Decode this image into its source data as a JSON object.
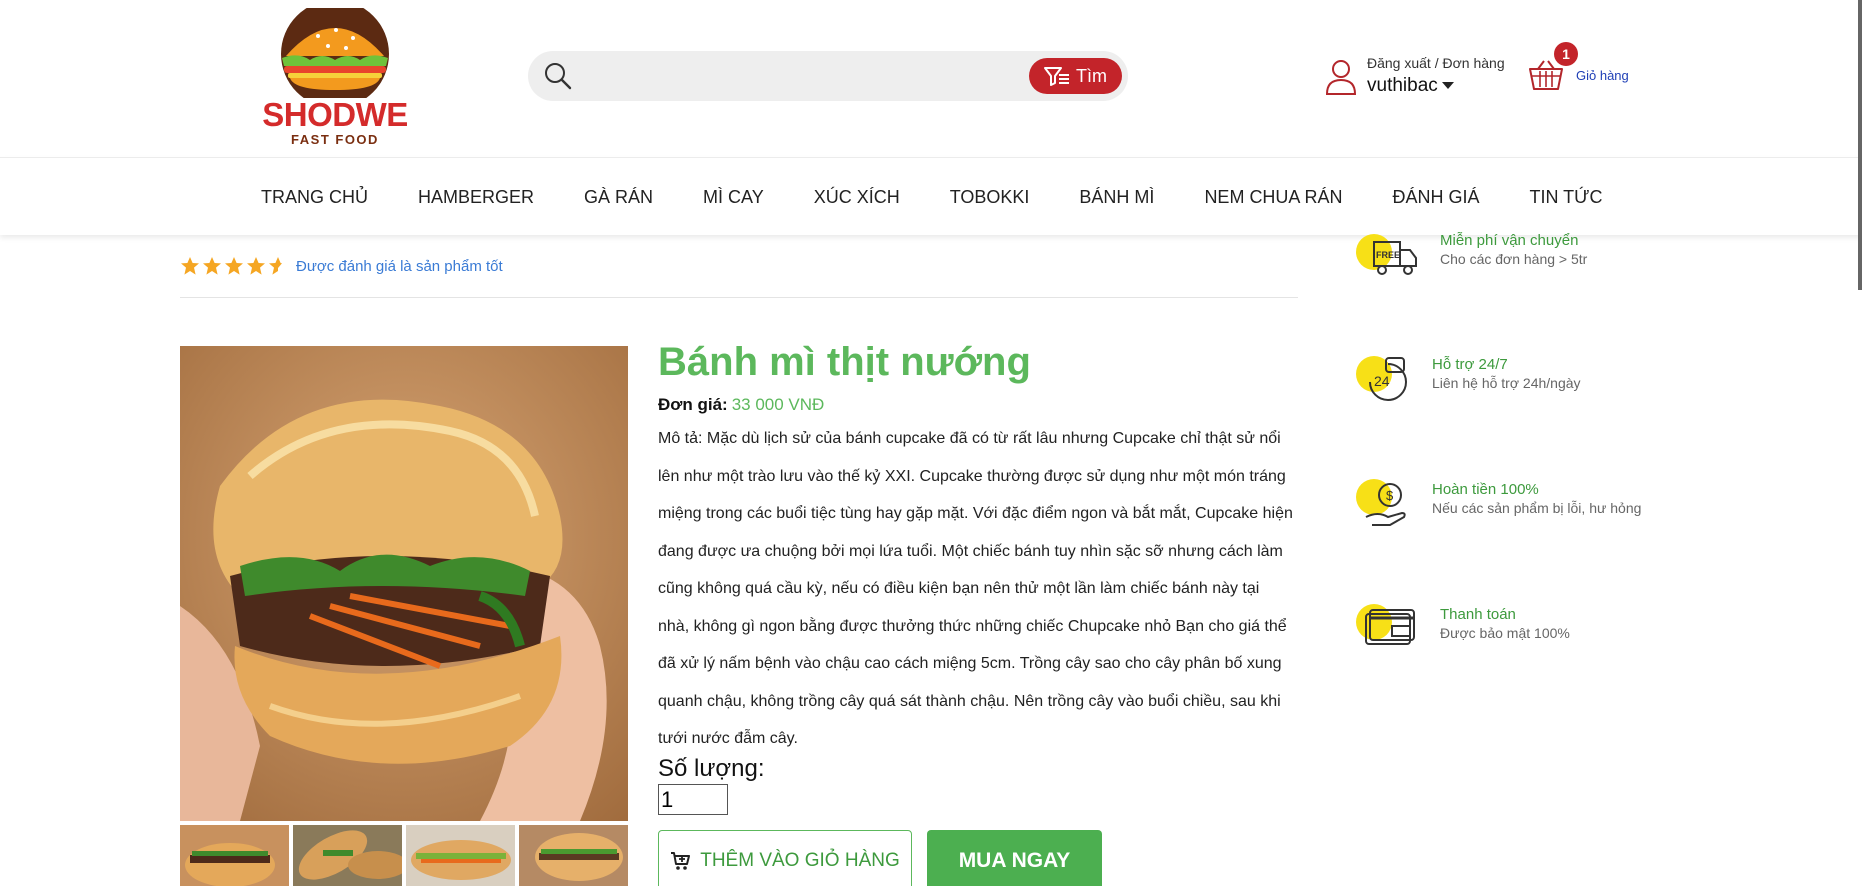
{
  "brand": {
    "name": "SHODWE",
    "tagline": "FAST FOOD"
  },
  "search": {
    "placeholder": "",
    "button_label": "Tìm"
  },
  "account": {
    "links": "Đăng xuất / Đơn hàng",
    "username": "vuthibac"
  },
  "cart": {
    "count": "1",
    "label": "Giỏ hàng"
  },
  "nav": {
    "items": [
      {
        "label": "TRANG CHỦ"
      },
      {
        "label": "HAMBERGER"
      },
      {
        "label": "GÀ RÁN"
      },
      {
        "label": "MÌ CAY"
      },
      {
        "label": "XÚC XÍCH"
      },
      {
        "label": "TOBOKKI"
      },
      {
        "label": "BÁNH MÌ"
      },
      {
        "label": "NEM CHUA RÁN"
      },
      {
        "label": "ĐÁNH GIÁ"
      },
      {
        "label": "TIN TỨC"
      }
    ]
  },
  "rating": {
    "stars": 4.5,
    "max": 5,
    "text": "Được đánh giá là sản phẩm tốt"
  },
  "product": {
    "title": "Bánh mì thịt nướng",
    "price_label": "Đơn giá:",
    "price_value": "33 000 VNĐ",
    "description": "Mô tả: Mặc dù lịch sử của bánh cupcake đã có từ rất lâu nhưng Cupcake chỉ thật sử nổi lên như một trào lưu vào thế kỷ XXI. Cupcake thường được sử dụng như một món tráng miệng trong các buổi tiệc tùng hay gặp mặt. Với đặc điểm ngon và bắt mắt, Cupcake hiện đang được ưa chuộng bởi mọi lứa tuổi. Một chiếc bánh tuy nhìn sặc sỡ nhưng cách làm cũng không quá cầu kỳ, nếu có điều kiện bạn nên thử một lần làm chiếc bánh này tại nhà, không gì ngon bằng được thưởng thức những chiếc Chupcake nhỏ Bạn cho giá thể đã xử lý nấm bệnh vào chậu cao cách miệng 5cm. Trồng cây sao cho cây phân bố xung quanh chậu, không trồng cây quá sát thành chậu. Nên trồng cây vào buổi chiều, sau khi tưới nước đẫm cây.",
    "quantity_label": "Số lượng:",
    "quantity_value": "1",
    "add_to_cart_label": "THÊM VÀO GIỎ HÀNG",
    "buy_now_label": "MUA NGAY"
  },
  "features": [
    {
      "icon": "free-delivery-truck-icon",
      "title": "Miễn phí vận chuyển",
      "subtitle": "Cho các đơn hàng > 5tr"
    },
    {
      "icon": "support-24-7-icon",
      "title": "Hỗ trợ 24/7",
      "subtitle": "Liên hệ hỗ trợ 24h/ngày"
    },
    {
      "icon": "money-back-icon",
      "title": "Hoàn tiền 100%",
      "subtitle": "Nếu các sản phẩm bị lỗi, hư hỏng"
    },
    {
      "icon": "credit-card-icon",
      "title": "Thanh toán",
      "subtitle": "Được bảo mật 100%"
    }
  ],
  "colors": {
    "brand_red": "#c3242a",
    "accent_green": "#5cb85c",
    "button_green": "#4caf50",
    "link_blue": "#3a7bd5",
    "feature_yellow": "#f7e017"
  }
}
